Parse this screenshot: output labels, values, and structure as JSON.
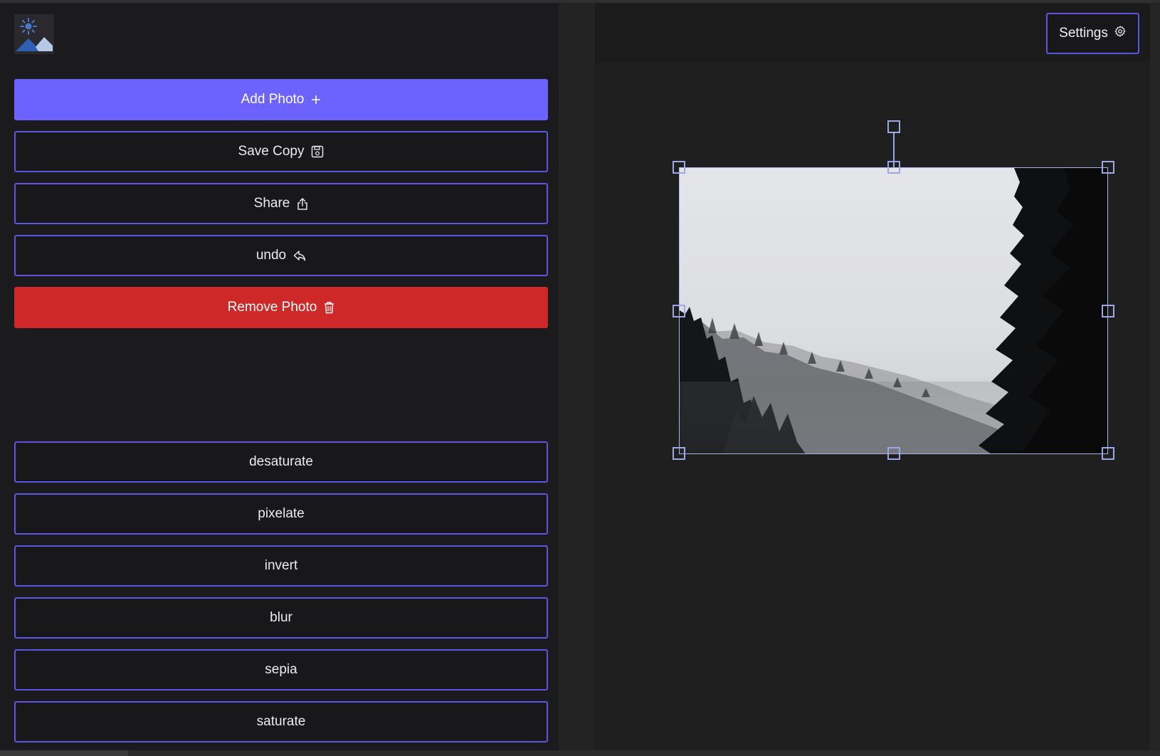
{
  "app": {
    "logo_icon": "image-sun-mountain-icon"
  },
  "sidebar": {
    "actions": [
      {
        "label": "Add Photo",
        "icon": "plus-icon",
        "variant": "primary"
      },
      {
        "label": "Save Copy",
        "icon": "save-icon",
        "variant": "outline"
      },
      {
        "label": "Share",
        "icon": "share-icon",
        "variant": "outline"
      },
      {
        "label": "undo",
        "icon": "undo-icon",
        "variant": "outline"
      },
      {
        "label": "Remove Photo",
        "icon": "trash-icon",
        "variant": "danger"
      }
    ],
    "filters": [
      {
        "label": "desaturate"
      },
      {
        "label": "pixelate"
      },
      {
        "label": "invert"
      },
      {
        "label": "blur"
      },
      {
        "label": "sepia"
      },
      {
        "label": "saturate"
      }
    ]
  },
  "header": {
    "settings_label": "Settings",
    "settings_icon": "gear-icon"
  },
  "canvas": {
    "image_subject": "foggy-forest-photo"
  },
  "colors": {
    "accent": "#6c63ff",
    "danger": "#cf2828",
    "border": "#5b55e0",
    "handle": "#9aa8e6"
  }
}
